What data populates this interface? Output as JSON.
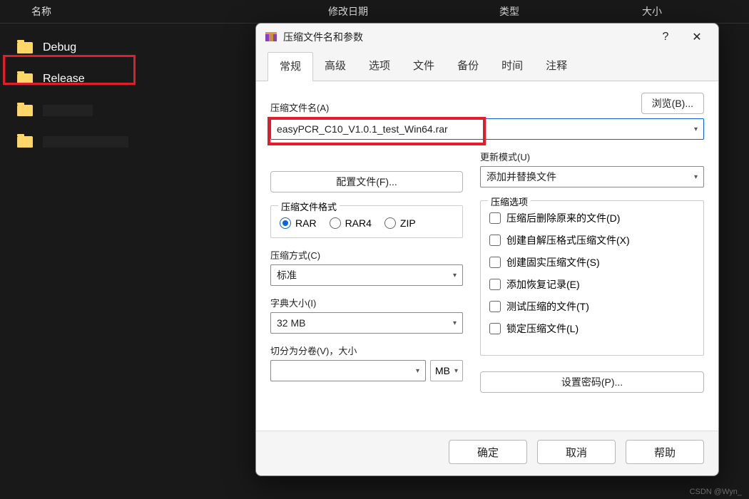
{
  "explorer": {
    "headers": {
      "name": "名称",
      "modified": "修改日期",
      "type": "类型",
      "size": "大小"
    },
    "folders": [
      "Debug",
      "Release"
    ]
  },
  "dialog": {
    "title": "压缩文件名和参数",
    "help_glyph": "?",
    "close_glyph": "✕",
    "tabs": [
      "常规",
      "高级",
      "选项",
      "文件",
      "备份",
      "时间",
      "注释"
    ],
    "active_tab": 0,
    "filename_label": "压缩文件名(A)",
    "browse_label": "浏览(B)...",
    "filename_value": "easyPCR_C10_V1.0.1_test_Win64.rar",
    "update_mode_label": "更新模式(U)",
    "update_mode_value": "添加并替换文件",
    "profiles_label": "配置文件(F)...",
    "format_group": "压缩文件格式",
    "formats": [
      "RAR",
      "RAR4",
      "ZIP"
    ],
    "format_selected": 0,
    "method_label": "压缩方式(C)",
    "method_value": "标准",
    "dict_label": "字典大小(I)",
    "dict_value": "32 MB",
    "split_label": "切分为分卷(V)，大小",
    "split_unit": "MB",
    "options_group": "压缩选项",
    "options": [
      "压缩后删除原来的文件(D)",
      "创建自解压格式压缩文件(X)",
      "创建固实压缩文件(S)",
      "添加恢复记录(E)",
      "测试压缩的文件(T)",
      "锁定压缩文件(L)"
    ],
    "set_password_label": "设置密码(P)...",
    "ok": "确定",
    "cancel": "取消",
    "help": "帮助"
  },
  "watermark": "CSDN @Wyn_"
}
